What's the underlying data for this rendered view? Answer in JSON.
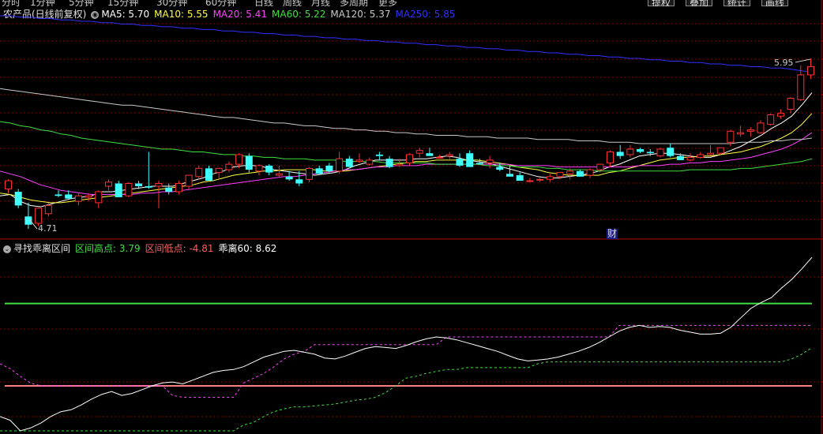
{
  "toolbar": {
    "periods": [
      "分时",
      "1分钟",
      "5分钟",
      "15分钟",
      "30分钟",
      "60分钟",
      "日线",
      "周线",
      "月线",
      "多周期",
      "更多"
    ],
    "buttons": [
      "提权",
      "叠加",
      "统计",
      "画线"
    ]
  },
  "main_chart": {
    "title": "农产品(日线前复权)",
    "ma": [
      {
        "label": "MA5",
        "value": "5.70",
        "color": "#ffffff"
      },
      {
        "label": "MA10",
        "value": "5.55",
        "color": "#ffff40"
      },
      {
        "label": "MA20",
        "value": "5.41",
        "color": "#ff40ff"
      },
      {
        "label": "MA60",
        "value": "5.22",
        "color": "#40e040"
      },
      {
        "label": "MA120",
        "value": "5.37",
        "color": "#c8c8c8"
      },
      {
        "label": "MA250",
        "value": "5.85",
        "color": "#3030ff"
      }
    ],
    "high_label": "5.95",
    "low_label": "4.71",
    "finance_marker": "财"
  },
  "indicator": {
    "name": "寻找乖离区间",
    "items": [
      {
        "label": "区间高点",
        "value": "3.79",
        "color": "#40e040"
      },
      {
        "label": "区间低点",
        "value": "-4.81",
        "color": "#ff6060"
      },
      {
        "label": "乖离60",
        "value": "8.62",
        "color": "#ffffff"
      }
    ]
  },
  "colors": {
    "up": "#ff3030",
    "down": "#40ffff",
    "grid": "#8a0000"
  },
  "chart_data": {
    "type": "candlestick",
    "price_range": [
      4.71,
      5.95
    ],
    "candles": [
      [
        5.0,
        5.07,
        4.97,
        5.06
      ],
      [
        4.98,
        5.0,
        4.86,
        4.88
      ],
      [
        4.8,
        4.9,
        4.71,
        4.74
      ],
      [
        4.75,
        4.86,
        4.73,
        4.86
      ],
      [
        4.82,
        4.9,
        4.8,
        4.88
      ],
      [
        4.96,
        4.99,
        4.94,
        4.95
      ],
      [
        4.96,
        4.99,
        4.93,
        4.93
      ],
      [
        4.91,
        4.97,
        4.88,
        4.95
      ],
      [
        4.94,
        4.97,
        4.91,
        4.95
      ],
      [
        4.9,
        4.99,
        4.86,
        4.98
      ],
      [
        5.02,
        5.07,
        4.99,
        5.05
      ],
      [
        5.04,
        5.06,
        4.94,
        4.94
      ],
      [
        4.95,
        5.05,
        4.94,
        5.04
      ],
      [
        5.04,
        5.06,
        5.0,
        5.02
      ],
      [
        5.02,
        5.27,
        5.0,
        5.01
      ],
      [
        5.02,
        5.06,
        4.86,
        5.04
      ],
      [
        5.01,
        5.04,
        4.96,
        4.98
      ],
      [
        4.98,
        5.06,
        4.96,
        5.04
      ],
      [
        5.02,
        5.1,
        5.0,
        5.1
      ],
      [
        5.09,
        5.17,
        5.07,
        5.15
      ],
      [
        5.15,
        5.17,
        5.06,
        5.06
      ],
      [
        5.12,
        5.15,
        5.07,
        5.15
      ],
      [
        5.14,
        5.2,
        5.12,
        5.18
      ],
      [
        5.18,
        5.26,
        5.15,
        5.25
      ],
      [
        5.24,
        5.26,
        5.12,
        5.14
      ],
      [
        5.13,
        5.18,
        5.1,
        5.17
      ],
      [
        5.17,
        5.18,
        5.1,
        5.12
      ],
      [
        5.1,
        5.17,
        5.09,
        5.11
      ],
      [
        5.09,
        5.13,
        5.06,
        5.07
      ],
      [
        5.07,
        5.13,
        5.02,
        5.04
      ],
      [
        5.07,
        5.16,
        5.05,
        5.15
      ],
      [
        5.15,
        5.17,
        5.11,
        5.11
      ],
      [
        5.17,
        5.19,
        5.12,
        5.13
      ],
      [
        5.13,
        5.27,
        5.11,
        5.22
      ],
      [
        5.22,
        5.24,
        5.16,
        5.16
      ],
      [
        5.2,
        5.26,
        5.19,
        5.21
      ],
      [
        5.18,
        5.23,
        5.17,
        5.21
      ],
      [
        5.25,
        5.27,
        5.21,
        5.24
      ],
      [
        5.22,
        5.24,
        5.15,
        5.16
      ],
      [
        5.17,
        5.22,
        5.16,
        5.18
      ],
      [
        5.19,
        5.26,
        5.17,
        5.25
      ],
      [
        5.26,
        5.3,
        5.23,
        5.28
      ],
      [
        5.26,
        5.3,
        5.24,
        5.24
      ],
      [
        5.23,
        5.25,
        5.22,
        5.23
      ],
      [
        5.24,
        5.27,
        5.22,
        5.25
      ],
      [
        5.22,
        5.26,
        5.16,
        5.17
      ],
      [
        5.26,
        5.28,
        5.16,
        5.16
      ],
      [
        5.19,
        5.22,
        5.18,
        5.18
      ],
      [
        5.19,
        5.24,
        5.15,
        5.21
      ],
      [
        5.16,
        5.19,
        5.13,
        5.14
      ],
      [
        5.11,
        5.17,
        5.09,
        5.09
      ],
      [
        5.1,
        5.12,
        5.06,
        5.06
      ],
      [
        5.06,
        5.08,
        5.05,
        5.06
      ],
      [
        5.07,
        5.08,
        5.05,
        5.07
      ],
      [
        5.07,
        5.11,
        5.05,
        5.09
      ],
      [
        5.09,
        5.12,
        5.07,
        5.12
      ],
      [
        5.11,
        5.15,
        5.07,
        5.13
      ],
      [
        5.13,
        5.14,
        5.09,
        5.09
      ],
      [
        5.1,
        5.15,
        5.08,
        5.14
      ],
      [
        5.14,
        5.18,
        5.12,
        5.18
      ],
      [
        5.19,
        5.28,
        5.16,
        5.27
      ],
      [
        5.27,
        5.32,
        5.22,
        5.24
      ],
      [
        5.25,
        5.32,
        5.23,
        5.29
      ],
      [
        5.29,
        5.3,
        5.26,
        5.27
      ],
      [
        5.27,
        5.29,
        5.24,
        5.26
      ],
      [
        5.24,
        5.3,
        5.23,
        5.29
      ],
      [
        5.3,
        5.33,
        5.23,
        5.24
      ],
      [
        5.24,
        5.26,
        5.21,
        5.21
      ],
      [
        5.21,
        5.26,
        5.2,
        5.23
      ],
      [
        5.23,
        5.27,
        5.22,
        5.25
      ],
      [
        5.25,
        5.32,
        5.24,
        5.26
      ],
      [
        5.26,
        5.3,
        5.25,
        5.3
      ],
      [
        5.34,
        5.43,
        5.31,
        5.42
      ],
      [
        5.4,
        5.46,
        5.38,
        5.41
      ],
      [
        5.42,
        5.45,
        5.38,
        5.43
      ],
      [
        5.41,
        5.5,
        5.4,
        5.48
      ],
      [
        5.47,
        5.55,
        5.46,
        5.54
      ],
      [
        5.53,
        5.58,
        5.51,
        5.55
      ],
      [
        5.58,
        5.67,
        5.55,
        5.66
      ],
      [
        5.65,
        5.9,
        5.64,
        5.83
      ],
      [
        5.83,
        5.95,
        5.8,
        5.89
      ]
    ],
    "ma": {
      "MA5": [
        4.95,
        4.96,
        4.91,
        4.88,
        4.87,
        4.89,
        4.91,
        4.93,
        4.94,
        4.95,
        4.98,
        4.98,
        4.99,
        5.0,
        5.01,
        5.02,
        5.02,
        5.02,
        5.04,
        5.06,
        5.08,
        5.11,
        5.13,
        5.16,
        5.17,
        5.17,
        5.16,
        5.14,
        5.13,
        5.12,
        5.11,
        5.1,
        5.11,
        5.12,
        5.14,
        5.17,
        5.19,
        5.21,
        5.21,
        5.21,
        5.21,
        5.22,
        5.22,
        5.23,
        5.24,
        5.23,
        5.21,
        5.2,
        5.19,
        5.17,
        5.15,
        5.13,
        5.11,
        5.09,
        5.08,
        5.08,
        5.09,
        5.1,
        5.11,
        5.13,
        5.16,
        5.18,
        5.21,
        5.24,
        5.25,
        5.26,
        5.26,
        5.25,
        5.24,
        5.23,
        5.23,
        5.25,
        5.28,
        5.31,
        5.35,
        5.39,
        5.44,
        5.48,
        5.53,
        5.61,
        5.7
      ],
      "MA10": [
        4.97,
        4.96,
        4.94,
        4.92,
        4.91,
        4.9,
        4.9,
        4.91,
        4.92,
        4.93,
        4.94,
        4.95,
        4.96,
        4.97,
        4.98,
        4.99,
        5.0,
        5.01,
        5.02,
        5.03,
        5.05,
        5.06,
        5.08,
        5.1,
        5.11,
        5.12,
        5.13,
        5.13,
        5.14,
        5.14,
        5.14,
        5.14,
        5.13,
        5.13,
        5.13,
        5.14,
        5.15,
        5.16,
        5.17,
        5.18,
        5.19,
        5.2,
        5.2,
        5.21,
        5.21,
        5.21,
        5.21,
        5.21,
        5.2,
        5.19,
        5.18,
        5.16,
        5.15,
        5.14,
        5.12,
        5.11,
        5.1,
        5.1,
        5.1,
        5.1,
        5.12,
        5.13,
        5.15,
        5.17,
        5.19,
        5.21,
        5.22,
        5.23,
        5.23,
        5.24,
        5.24,
        5.25,
        5.26,
        5.27,
        5.29,
        5.31,
        5.34,
        5.37,
        5.41,
        5.47,
        5.55
      ],
      "MA20": [
        5.13,
        5.11,
        5.09,
        5.06,
        5.03,
        5.01,
        4.99,
        4.98,
        4.97,
        4.96,
        4.96,
        4.96,
        4.96,
        4.96,
        4.97,
        4.97,
        4.98,
        4.98,
        4.99,
        5.0,
        5.01,
        5.02,
        5.03,
        5.04,
        5.05,
        5.06,
        5.07,
        5.08,
        5.09,
        5.09,
        5.1,
        5.11,
        5.12,
        5.13,
        5.14,
        5.14,
        5.15,
        5.16,
        5.16,
        5.17,
        5.17,
        5.17,
        5.18,
        5.18,
        5.18,
        5.18,
        5.18,
        5.18,
        5.18,
        5.18,
        5.18,
        5.17,
        5.17,
        5.17,
        5.17,
        5.16,
        5.16,
        5.16,
        5.16,
        5.16,
        5.16,
        5.16,
        5.16,
        5.17,
        5.17,
        5.17,
        5.18,
        5.18,
        5.19,
        5.19,
        5.2,
        5.2,
        5.21,
        5.22,
        5.23,
        5.25,
        5.27,
        5.29,
        5.32,
        5.36,
        5.41
      ],
      "MA60": [
        5.49,
        5.48,
        5.46,
        5.45,
        5.43,
        5.42,
        5.4,
        5.39,
        5.37,
        5.36,
        5.35,
        5.34,
        5.33,
        5.32,
        5.31,
        5.3,
        5.29,
        5.29,
        5.28,
        5.27,
        5.27,
        5.26,
        5.25,
        5.25,
        5.24,
        5.24,
        5.23,
        5.23,
        5.22,
        5.22,
        5.22,
        5.21,
        5.21,
        5.21,
        5.2,
        5.2,
        5.2,
        5.2,
        5.19,
        5.19,
        5.19,
        5.19,
        5.19,
        5.18,
        5.18,
        5.18,
        5.18,
        5.18,
        5.17,
        5.17,
        5.17,
        5.16,
        5.16,
        5.16,
        5.15,
        5.15,
        5.14,
        5.14,
        5.14,
        5.13,
        5.13,
        5.13,
        5.13,
        5.13,
        5.13,
        5.13,
        5.13,
        5.13,
        5.14,
        5.14,
        5.14,
        5.14,
        5.14,
        5.15,
        5.15,
        5.16,
        5.17,
        5.18,
        5.19,
        5.2,
        5.22
      ],
      "MA120": [
        5.73,
        5.72,
        5.71,
        5.7,
        5.69,
        5.68,
        5.67,
        5.66,
        5.65,
        5.64,
        5.63,
        5.62,
        5.61,
        5.61,
        5.6,
        5.59,
        5.58,
        5.57,
        5.56,
        5.55,
        5.54,
        5.53,
        5.52,
        5.52,
        5.51,
        5.5,
        5.49,
        5.48,
        5.48,
        5.47,
        5.46,
        5.46,
        5.45,
        5.44,
        5.44,
        5.43,
        5.43,
        5.42,
        5.42,
        5.41,
        5.41,
        5.4,
        5.4,
        5.39,
        5.39,
        5.39,
        5.38,
        5.38,
        5.38,
        5.37,
        5.37,
        5.37,
        5.37,
        5.36,
        5.36,
        5.36,
        5.36,
        5.35,
        5.35,
        5.35,
        5.34,
        5.34,
        5.34,
        5.33,
        5.33,
        5.33,
        5.33,
        5.33,
        5.33,
        5.33,
        5.33,
        5.33,
        5.33,
        5.34,
        5.34,
        5.34,
        5.35,
        5.35,
        5.36,
        5.36,
        5.37
      ],
      "MA250": [
        6.26,
        6.26,
        6.25,
        6.25,
        6.24,
        6.24,
        6.23,
        6.23,
        6.22,
        6.22,
        6.21,
        6.21,
        6.2,
        6.2,
        6.19,
        6.19,
        6.18,
        6.18,
        6.17,
        6.17,
        6.16,
        6.16,
        6.15,
        6.15,
        6.14,
        6.14,
        6.13,
        6.13,
        6.12,
        6.12,
        6.11,
        6.11,
        6.1,
        6.1,
        6.09,
        6.09,
        6.08,
        6.08,
        6.07,
        6.07,
        6.06,
        6.06,
        6.05,
        6.05,
        6.04,
        6.04,
        6.03,
        6.03,
        6.02,
        6.02,
        6.01,
        6.01,
        6.0,
        6.0,
        5.99,
        5.99,
        5.98,
        5.98,
        5.97,
        5.97,
        5.96,
        5.96,
        5.95,
        5.95,
        5.94,
        5.94,
        5.93,
        5.93,
        5.92,
        5.92,
        5.91,
        5.91,
        5.9,
        5.9,
        5.89,
        5.89,
        5.88,
        5.88,
        5.87,
        5.86,
        5.85
      ]
    },
    "indicator_range": [
      -9.5,
      8.62
    ],
    "high_line": 3.79,
    "low_line": -4.81,
    "deviation": [
      -8.0,
      -8.4,
      -9.5,
      -9.2,
      -8.7,
      -8.0,
      -7.5,
      -7.3,
      -6.8,
      -6.2,
      -5.7,
      -5.4,
      -5.8,
      -5.6,
      -5.2,
      -4.8,
      -4.5,
      -4.4,
      -4.6,
      -4.2,
      -3.8,
      -3.4,
      -3.2,
      -3.1,
      -2.8,
      -2.3,
      -1.8,
      -1.5,
      -1.2,
      -1.1,
      -1.3,
      -1.5,
      -1.9,
      -2.0,
      -1.7,
      -1.3,
      -0.9,
      -0.7,
      -0.8,
      -0.9,
      -0.6,
      -0.2,
      0.1,
      0.3,
      0.2,
      0.0,
      -0.3,
      -0.6,
      -0.9,
      -1.2,
      -1.6,
      -2.0,
      -2.2,
      -2.1,
      -2.0,
      -1.8,
      -1.5,
      -1.2,
      -0.8,
      -0.3,
      0.3,
      0.9,
      1.3,
      1.5,
      1.3,
      1.4,
      1.3,
      1.0,
      0.8,
      0.6,
      0.6,
      0.7,
      1.3,
      2.3,
      3.3,
      3.9,
      4.4,
      5.4,
      6.3,
      7.4,
      8.6
    ],
    "dev_high_track": [
      -2.5,
      -3.0,
      -3.8,
      -4.5,
      -4.8,
      -4.8,
      -4.8,
      -4.8,
      -4.8,
      -4.8,
      -4.8,
      -4.8,
      -4.8,
      -4.8,
      -4.8,
      -4.8,
      -4.8,
      -5.8,
      -6.0,
      -6.0,
      -6.0,
      -6.0,
      -6.0,
      -6.0,
      -4.5,
      -4.0,
      -3.5,
      -2.8,
      -2.0,
      -1.5,
      -1.2,
      -0.5,
      -0.5,
      -0.5,
      -0.5,
      -0.5,
      -0.5,
      -0.5,
      -0.5,
      -0.5,
      -0.5,
      -0.5,
      -0.5,
      -0.5,
      0.3,
      0.3,
      0.3,
      0.3,
      0.3,
      0.3,
      0.3,
      0.3,
      0.3,
      0.3,
      0.3,
      0.3,
      0.3,
      0.3,
      0.3,
      0.3,
      0.3,
      1.5,
      1.5,
      1.5,
      1.5,
      1.5,
      1.5,
      1.5,
      1.5,
      1.5,
      1.5,
      1.5,
      1.5,
      1.5,
      1.5,
      1.5,
      1.5,
      1.5,
      1.5,
      1.5,
      1.5
    ],
    "dev_low_track": [
      -9.5,
      -9.5,
      -9.5,
      -9.5,
      -9.5,
      -9.5,
      -9.5,
      -9.5,
      -9.5,
      -9.5,
      -9.5,
      -9.5,
      -9.5,
      -9.5,
      -9.5,
      -9.5,
      -9.5,
      -9.5,
      -9.5,
      -9.5,
      -9.5,
      -9.5,
      -9.5,
      -9.5,
      -8.9,
      -8.6,
      -8.0,
      -7.5,
      -7.2,
      -7.0,
      -7.0,
      -6.9,
      -6.8,
      -6.7,
      -6.5,
      -6.3,
      -6.2,
      -6.0,
      -5.5,
      -4.8,
      -4.0,
      -3.8,
      -3.5,
      -3.3,
      -3.1,
      -3.1,
      -2.9,
      -2.9,
      -2.9,
      -2.9,
      -2.9,
      -2.9,
      -2.9,
      -2.5,
      -2.3,
      -2.3,
      -2.3,
      -2.3,
      -2.3,
      -2.3,
      -2.3,
      -2.3,
      -2.3,
      -2.3,
      -2.3,
      -2.3,
      -2.3,
      -2.3,
      -2.3,
      -2.3,
      -2.3,
      -2.3,
      -2.3,
      -2.3,
      -2.3,
      -2.3,
      -2.3,
      -2.3,
      -2.0,
      -1.5,
      -0.8
    ]
  }
}
